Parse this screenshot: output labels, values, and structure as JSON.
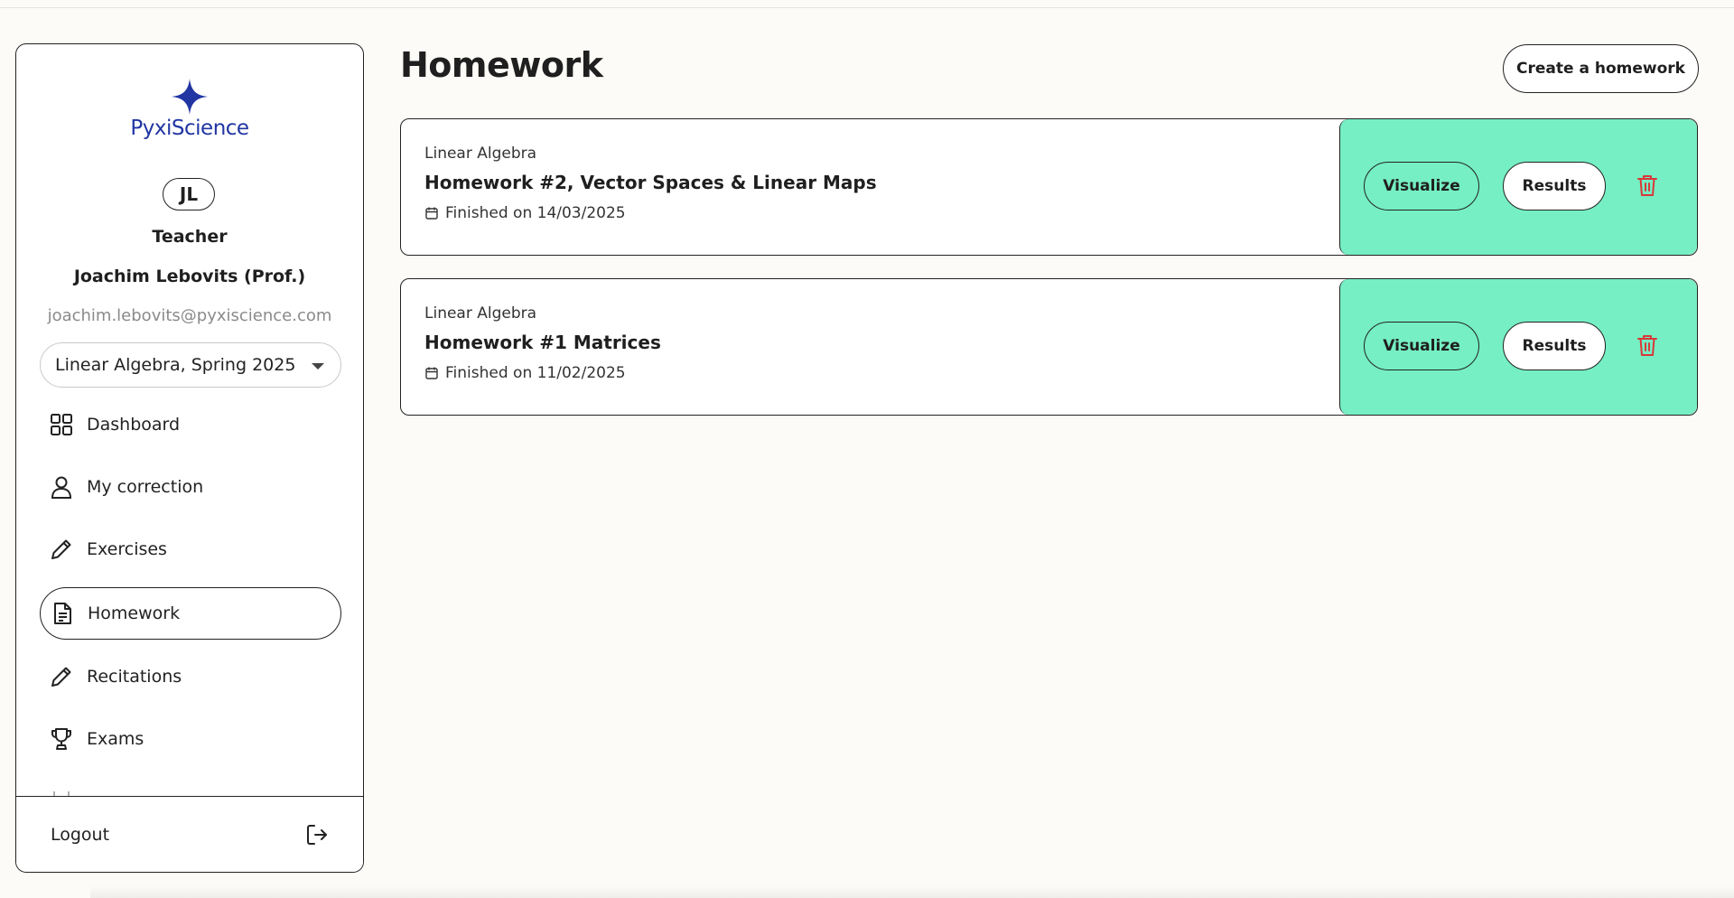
{
  "brand": {
    "name": "PyxiScience",
    "color": "#2136a3"
  },
  "user": {
    "initials": "JL",
    "role": "Teacher",
    "name": "Joachim Lebovits (Prof.)",
    "email": "joachim.lebovits@pyxiscience.com"
  },
  "course_select": {
    "value": "Linear Algebra, Spring 2025"
  },
  "nav": {
    "items": [
      {
        "label": "Dashboard",
        "icon": "dashboard-grid-icon"
      },
      {
        "label": "My correction",
        "icon": "user-icon"
      },
      {
        "label": "Exercises",
        "icon": "pencil-icon"
      },
      {
        "label": "Homework",
        "icon": "document-icon",
        "active": true
      },
      {
        "label": "Recitations",
        "icon": "pencil-icon"
      },
      {
        "label": "Exams",
        "icon": "trophy-icon"
      }
    ]
  },
  "logout": {
    "label": "Logout",
    "icon": "logout-icon"
  },
  "page": {
    "title": "Homework",
    "create_label": "Create a homework"
  },
  "homeworks": [
    {
      "course": "Linear Algebra",
      "title": "Homework #2, Vector Spaces & Linear Maps",
      "date": "Finished on 14/03/2025",
      "visualize_label": "Visualize",
      "results_label": "Results"
    },
    {
      "course": "Linear Algebra",
      "title": "Homework #1 Matrices",
      "date": "Finished on 11/02/2025",
      "visualize_label": "Visualize",
      "results_label": "Results"
    }
  ],
  "colors": {
    "accent_green": "#75efc3",
    "danger": "#d9383a",
    "background": "#fdfbf7"
  }
}
